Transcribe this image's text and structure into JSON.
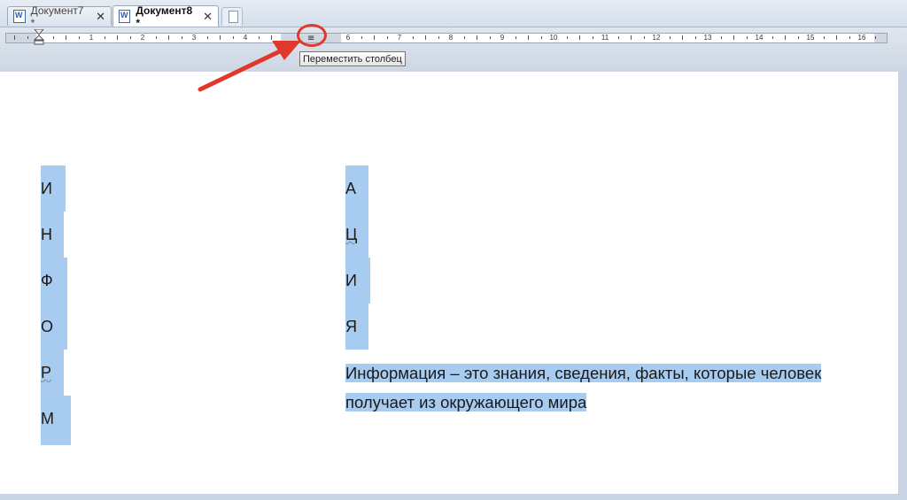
{
  "tabs": [
    {
      "label": "Документ7 *",
      "close": "✕"
    },
    {
      "label": "Документ8 *",
      "close": "✕"
    }
  ],
  "ruler": {
    "numbers": [
      "1",
      "1",
      "2",
      "3",
      "4",
      "6",
      "7",
      "8",
      "9",
      "10",
      "11",
      "12",
      "13",
      "14",
      "15",
      "16"
    ],
    "column_marker": "≡"
  },
  "tooltip": "Переместить столбец",
  "document": {
    "column1_letters": [
      "И",
      "Н",
      "Ф",
      "О",
      "Р",
      "М"
    ],
    "column2_letters": [
      "А",
      "Ц",
      "И",
      "Я"
    ],
    "paragraph_line1": "Информация – это знания, сведения, факты, которые человек",
    "paragraph_line2": "получает из окружающего мира"
  },
  "colors": {
    "selection": "#a8cbf0",
    "annotation": "#e0392b"
  }
}
